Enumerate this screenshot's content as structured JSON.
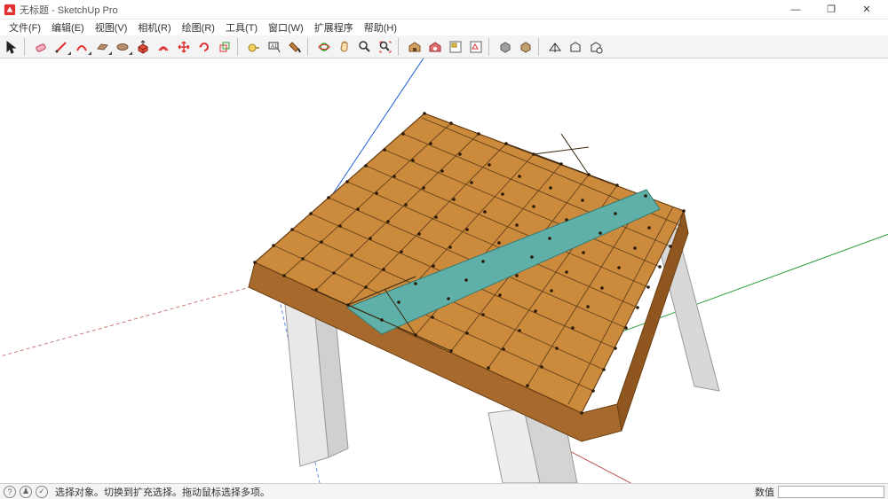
{
  "window": {
    "title": "无标题 - SketchUp Pro",
    "controls": {
      "minimize": "—",
      "maximize": "❐",
      "close": "✕"
    }
  },
  "menu": {
    "file": "文件(F)",
    "edit": "编辑(E)",
    "view": "视图(V)",
    "camera": "相机(R)",
    "draw": "绘图(R)",
    "tools": "工具(T)",
    "window": "窗口(W)",
    "extensions": "扩展程序",
    "help": "帮助(H)"
  },
  "toolbar_icons": {
    "select": "select-tool",
    "eraser": "eraser-tool",
    "line": "line-tool",
    "arc": "arc-tool",
    "rect": "rect-tool",
    "circle": "circle-tool",
    "pushpull": "pushpull-tool",
    "offset": "offset-tool",
    "move": "move-tool",
    "rotate": "rotate-tool",
    "scale": "scale-tool",
    "tape": "tape-tool",
    "text": "text-tool",
    "paint": "paint-tool",
    "orbit": "orbit-tool",
    "pan": "pan-tool",
    "zoom": "zoom-tool",
    "zoomext": "zoom-extents-tool",
    "warehouse": "3d-warehouse",
    "ext_warehouse": "extension-warehouse",
    "layout": "layout",
    "stylebuilder": "style-builder",
    "solid_outer": "solid-outer",
    "solid_union": "solid-union",
    "add_loc": "add-location",
    "building": "3d-building",
    "photo": "photo-textures"
  },
  "status": {
    "geo": "⊕",
    "credits": "👤",
    "claim": "✓",
    "hint": "选择对象。切换到扩充选择。拖动鼠标选择多项。",
    "value_label": "数值"
  }
}
